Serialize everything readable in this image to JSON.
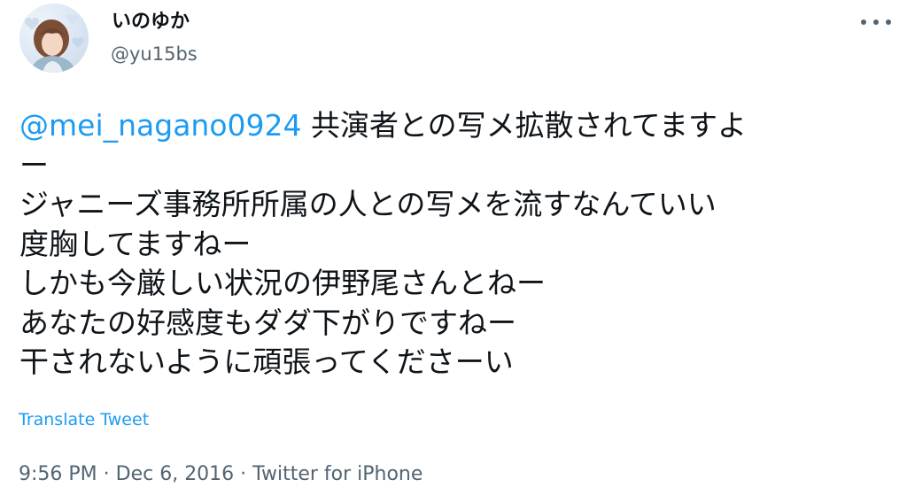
{
  "author": {
    "display_name": "いのゆか",
    "handle": "@yu15bs",
    "avatar_icon": "user-avatar"
  },
  "more_menu_icon": "more-horizontal-icon",
  "tweet": {
    "mention": "@mei_nagano0924",
    "lines": [
      " 共演者との写メ拡散されてますよ",
      "ー",
      "ジャニーズ事務所所属の人との写メを流すなんていい",
      "度胸してますねー",
      "しかも今厳しい状況の伊野尾さんとねー",
      "あなたの好感度もダダ下がりですねー",
      "干されないように頑張ってくださーい"
    ],
    "translate_label": "Translate Tweet"
  },
  "meta": {
    "time": "9:56 PM",
    "separator": " · ",
    "date": "Dec 6, 2016",
    "source": "Twitter for iPhone"
  },
  "colors": {
    "link": "#1d9bf0",
    "secondary": "#536471",
    "text": "#0f1419"
  }
}
